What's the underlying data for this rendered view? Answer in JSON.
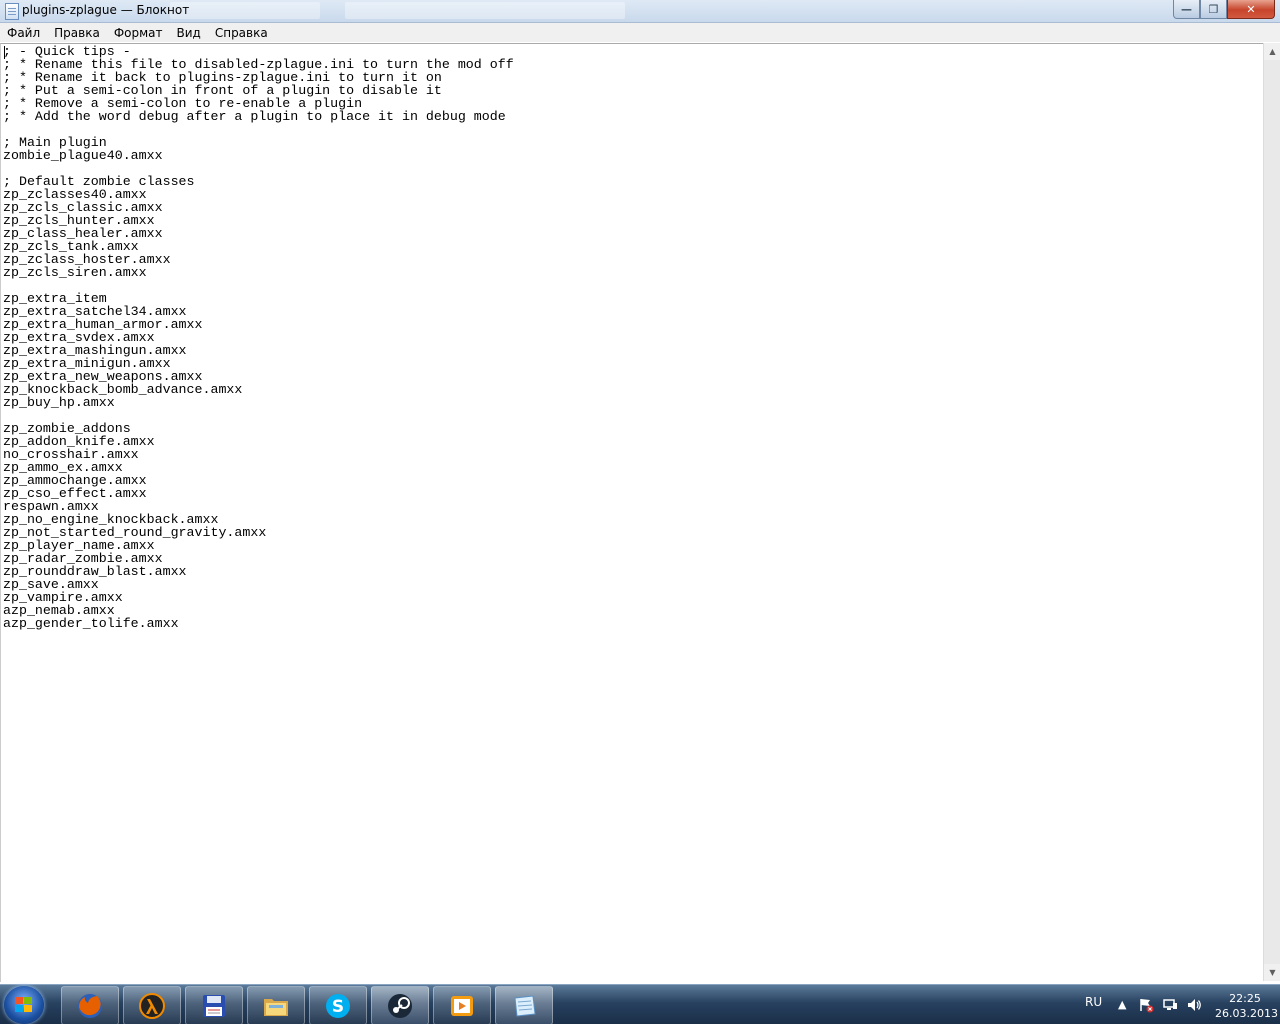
{
  "window": {
    "title": "plugins-zplague — Блокнот",
    "minimize_glyph": "—",
    "maximize_glyph": "❐",
    "close_glyph": "✕"
  },
  "menu": {
    "items": [
      "Файл",
      "Правка",
      "Формат",
      "Вид",
      "Справка"
    ]
  },
  "editor": {
    "content": "; - Quick tips -\n; * Rename this file to disabled-zplague.ini to turn the mod off\n; * Rename it back to plugins-zplague.ini to turn it on\n; * Put a semi-colon in front of a plugin to disable it\n; * Remove a semi-colon to re-enable a plugin\n; * Add the word debug after a plugin to place it in debug mode\n\n; Main plugin\nzombie_plague40.amxx\n\n; Default zombie classes\nzp_zclasses40.amxx\nzp_zcls_classic.amxx\nzp_zcls_hunter.amxx\nzp_class_healer.amxx\nzp_zcls_tank.amxx\nzp_zclass_hoster.amxx\nzp_zcls_siren.amxx\n\nzp_extra_item\nzp_extra_satchel34.amxx\nzp_extra_human_armor.amxx\nzp_extra_svdex.amxx\nzp_extra_mashingun.amxx\nzp_extra_minigun.amxx\nzp_extra_new_weapons.amxx\nzp_knockback_bomb_advance.amxx\nzp_buy_hp.amxx\n\nzp_zombie_addons\nzp_addon_knife.amxx\nno_crosshair.amxx\nzp_ammo_ex.amxx\nzp_ammochange.amxx\nzp_cso_effect.amxx\nrespawn.amxx\nzp_no_engine_knockback.amxx\nzp_not_started_round_gravity.amxx\nzp_player_name.amxx\nzp_radar_zombie.amxx\nzp_rounddraw_blast.amxx\nzp_save.amxx\nzp_vampire.amxx\nazp_nemab.amxx\nazp_gender_tolife.amxx"
  },
  "taskbar": {
    "apps": [
      {
        "icon": "firefox-icon",
        "color": "#e66000"
      },
      {
        "icon": "half-life-icon",
        "color": "#f08a00"
      },
      {
        "icon": "floppy-save-icon",
        "color": "#2a4db0"
      },
      {
        "icon": "file-explorer-icon",
        "color": "#e8c060"
      },
      {
        "icon": "skype-icon",
        "color": "#00aff0"
      },
      {
        "icon": "steam-icon",
        "color": "#1b2838"
      },
      {
        "icon": "media-player-icon",
        "color": "#f39c12"
      },
      {
        "icon": "notepad-icon",
        "color": "#9fc8e8"
      }
    ],
    "language": "RU",
    "time": "22:25",
    "date": "26.03.2013"
  }
}
